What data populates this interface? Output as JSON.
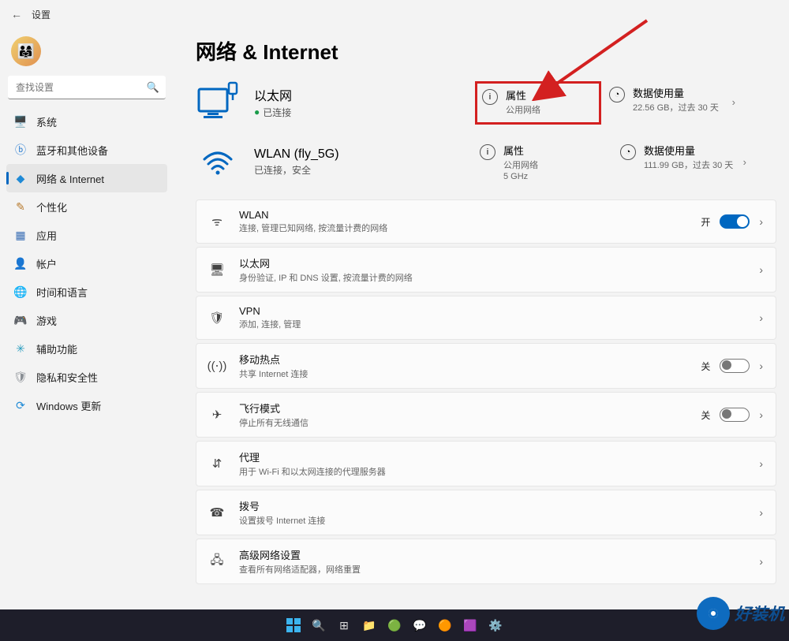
{
  "header": {
    "title": "设置"
  },
  "search": {
    "placeholder": "查找设置"
  },
  "sidebar": {
    "items": [
      {
        "icon": "🖥️",
        "label": "系统",
        "color": "#3b82c4"
      },
      {
        "icon": "ⓑ",
        "label": "蓝牙和其他设备",
        "color": "#2a7dd1"
      },
      {
        "icon": "◆",
        "label": "网络 & Internet",
        "color": "#1f8ad6",
        "active": true
      },
      {
        "icon": "✎",
        "label": "个性化",
        "color": "#b7792b"
      },
      {
        "icon": "▦",
        "label": "应用",
        "color": "#3b6fb5"
      },
      {
        "icon": "👤",
        "label": "帐户",
        "color": "#d96b3a"
      },
      {
        "icon": "🌐",
        "label": "时间和语言",
        "color": "#3b82c4"
      },
      {
        "icon": "🎮",
        "label": "游戏",
        "color": "#7a7a7a"
      },
      {
        "icon": "✳",
        "label": "辅助功能",
        "color": "#2a9dbf"
      },
      {
        "icon": "🛡",
        "label": "隐私和安全性",
        "color": "#8a8f95"
      },
      {
        "icon": "⟳",
        "label": "Windows 更新",
        "color": "#1f8ad6"
      }
    ]
  },
  "page": {
    "title": "网络 & Internet"
  },
  "networks": {
    "ethernet": {
      "name": "以太网",
      "status": "已连接",
      "property": {
        "title": "属性",
        "sub": "公用网络"
      },
      "usage": {
        "title": "数据使用量",
        "sub": "22.56 GB，过去 30 天"
      }
    },
    "wlan": {
      "name": "WLAN (fly_5G)",
      "status": "已连接，安全",
      "band": "5 GHz",
      "property": {
        "title": "属性",
        "sub": "公用网络"
      },
      "usage": {
        "title": "数据使用量",
        "sub": "111.99 GB，过去 30 天"
      }
    }
  },
  "settings_list": [
    {
      "id": "wlan",
      "title": "WLAN",
      "sub": "连接, 管理已知网络, 按流量计费的网络",
      "toggle": "on",
      "state_label": "开"
    },
    {
      "id": "ethernet",
      "title": "以太网",
      "sub": "身份验证, IP 和 DNS 设置, 按流量计费的网络"
    },
    {
      "id": "vpn",
      "title": "VPN",
      "sub": "添加, 连接, 管理"
    },
    {
      "id": "hotspot",
      "title": "移动热点",
      "sub": "共享 Internet 连接",
      "toggle": "off",
      "state_label": "关"
    },
    {
      "id": "airplane",
      "title": "飞行模式",
      "sub": "停止所有无线通信",
      "toggle": "off",
      "state_label": "关"
    },
    {
      "id": "proxy",
      "title": "代理",
      "sub": "用于 Wi-Fi 和以太网连接的代理服务器"
    },
    {
      "id": "dialup",
      "title": "拨号",
      "sub": "设置拨号 Internet 连接"
    },
    {
      "id": "advanced",
      "title": "高级网络设置",
      "sub": "查看所有网络适配器，网络重置"
    }
  ],
  "list_icons": {
    "wlan": "ᯤ",
    "ethernet": "🖥",
    "vpn": "🛡",
    "hotspot": "((⋅))",
    "airplane": "✈",
    "proxy": "⇵",
    "dialup": "☎",
    "advanced": "🖧"
  },
  "watermark": "好装机"
}
